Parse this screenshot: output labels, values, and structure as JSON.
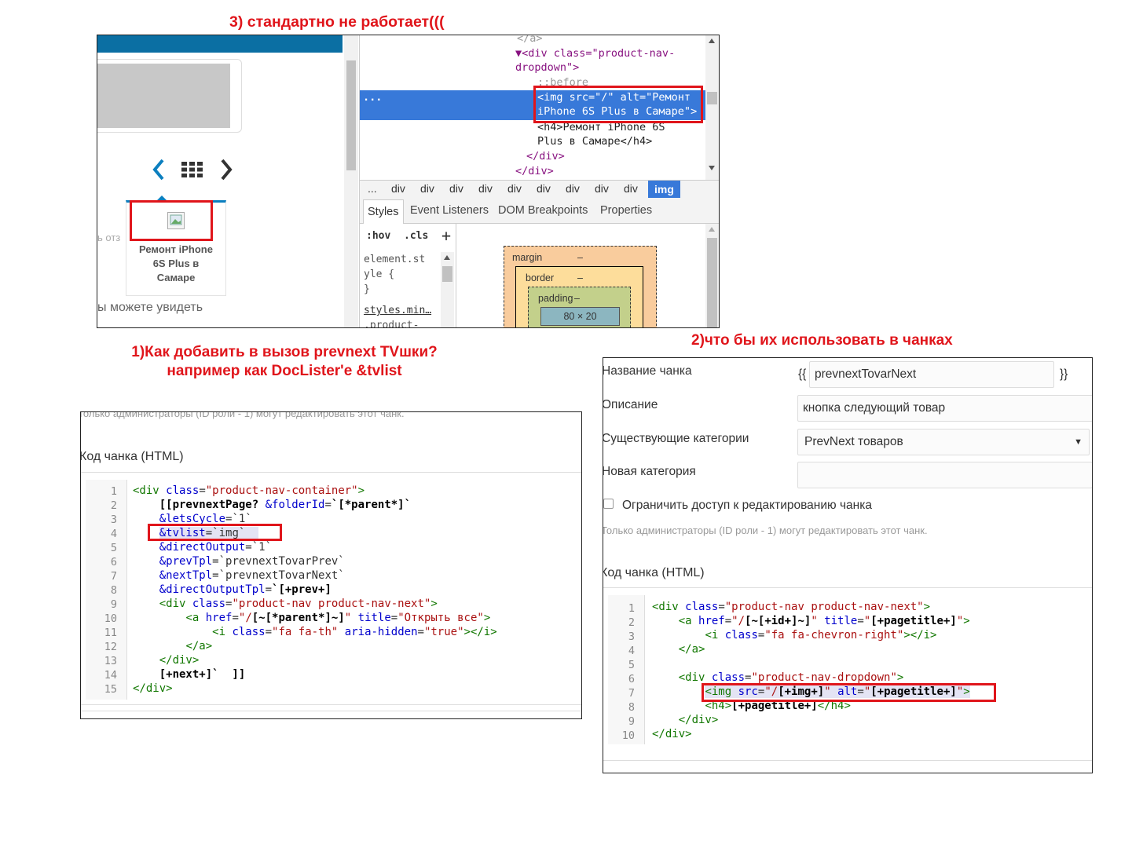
{
  "headings": {
    "h3": "3) стандартно не работает(((",
    "h1_line1": "1)Как добавить в вызов prevnext TVшки?",
    "h1_line2": "например как DocLister'e &tvlist",
    "h2": "2)что бы их использовать в чанках"
  },
  "site_preview": {
    "card_title": "Ремонт iPhone 6S Plus в Самаре",
    "card_title_lines": [
      "Ремонт iPhone",
      "6S Plus в",
      "Самаре"
    ],
    "partial_left_text": "ь отз",
    "bottom_text": "ы можете увидеть",
    "nav": {
      "prev": "‹",
      "grid": "grid",
      "next": "›"
    }
  },
  "devtools": {
    "code_lines": [
      "</a>",
      "▼<div class=\"product-nav-",
      "dropdown\">",
      "::before",
      "<img src=\"/\" alt=\"Ремонт",
      "iPhone 6S Plus в Самаре\">",
      "<h4>Ремонт  iPhone 6S",
      "Plus в Самаре</h4>",
      "</div>",
      "</div>"
    ],
    "ellipsis": "...",
    "breadcrumbs": [
      "...",
      "div",
      "div",
      "div",
      "div",
      "div",
      "div",
      "div",
      "div",
      "div",
      "img"
    ],
    "tabs": [
      "Styles",
      "Event Listeners",
      "DOM Breakpoints",
      "Properties"
    ],
    "filter": {
      "hov": ":hov",
      "cls": ".cls",
      "add": "+"
    },
    "styles_rules": [
      "element.st",
      "yle {",
      "}",
      "styles.min…",
      ".product-"
    ],
    "box_model": {
      "margin": "margin",
      "border": "border",
      "padding": "padding",
      "dash": "–",
      "content": "80 × 20"
    }
  },
  "chunk_left": {
    "top_note": "Только администраторы (ID роли - 1) могут редактировать этот чанк.",
    "label": "Код чанка (HTML)",
    "line_numbers": [
      "1",
      "2",
      "3",
      "4",
      "5",
      "6",
      "7",
      "8",
      "9",
      "10",
      "11",
      "12",
      "13",
      "14",
      "15"
    ]
  },
  "chunk_right": {
    "fields": {
      "name_label": "Название чанка",
      "name_prefix": "{{",
      "name_value": "prevnextTovarNext",
      "name_suffix": "}}",
      "desc_label": "Описание",
      "desc_value": "кнопка следующий товар",
      "cat_label": "Существующие категории",
      "cat_value": "PrevNext товаров",
      "newcat_label": "Новая категория",
      "newcat_value": "",
      "restrict_label": "Ограничить доступ к редактированию чанка",
      "restrict_note": "Только администраторы (ID роли - 1) могут редактировать этот чанк.",
      "code_label": "Код чанка (HTML)"
    },
    "line_numbers": [
      "1",
      "2",
      "3",
      "4",
      "5",
      "6",
      "7",
      "8",
      "9",
      "10"
    ]
  }
}
